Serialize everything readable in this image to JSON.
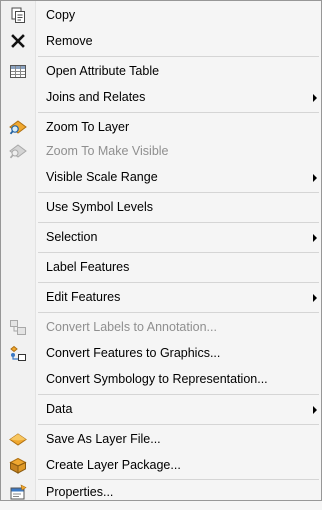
{
  "menu": {
    "items": [
      {
        "label": "Copy",
        "icon": "copy-icon"
      },
      {
        "label": "Remove",
        "icon": "remove-x-icon"
      },
      {
        "label": "Open Attribute Table",
        "icon": "attribute-table-icon"
      },
      {
        "label": "Joins and Relates",
        "submenu": true
      },
      {
        "label": "Zoom To Layer",
        "icon": "zoom-to-layer-icon"
      },
      {
        "label": "Zoom To Make Visible",
        "icon": "zoom-to-make-visible-icon",
        "disabled": true
      },
      {
        "label": "Visible Scale Range",
        "submenu": true
      },
      {
        "label": "Use Symbol Levels"
      },
      {
        "label": "Selection",
        "submenu": true
      },
      {
        "label": "Label Features"
      },
      {
        "label": "Edit Features",
        "submenu": true
      },
      {
        "label": "Convert Labels to Annotation...",
        "icon": "convert-labels-icon",
        "disabled": true
      },
      {
        "label": "Convert Features to Graphics...",
        "icon": "convert-graphics-icon"
      },
      {
        "label": "Convert Symbology to Representation..."
      },
      {
        "label": "Data",
        "submenu": true
      },
      {
        "label": "Save As Layer File...",
        "icon": "layer-file-icon"
      },
      {
        "label": "Create Layer Package...",
        "icon": "layer-package-icon"
      },
      {
        "label": "Properties...",
        "icon": "properties-icon"
      }
    ]
  },
  "colors": {
    "menu_background": "#f5f5f5",
    "border": "#979797",
    "disabled_text": "#8f8f8f",
    "separator": "#d5d5d5",
    "layer_icon_orange": "#f0a830"
  }
}
